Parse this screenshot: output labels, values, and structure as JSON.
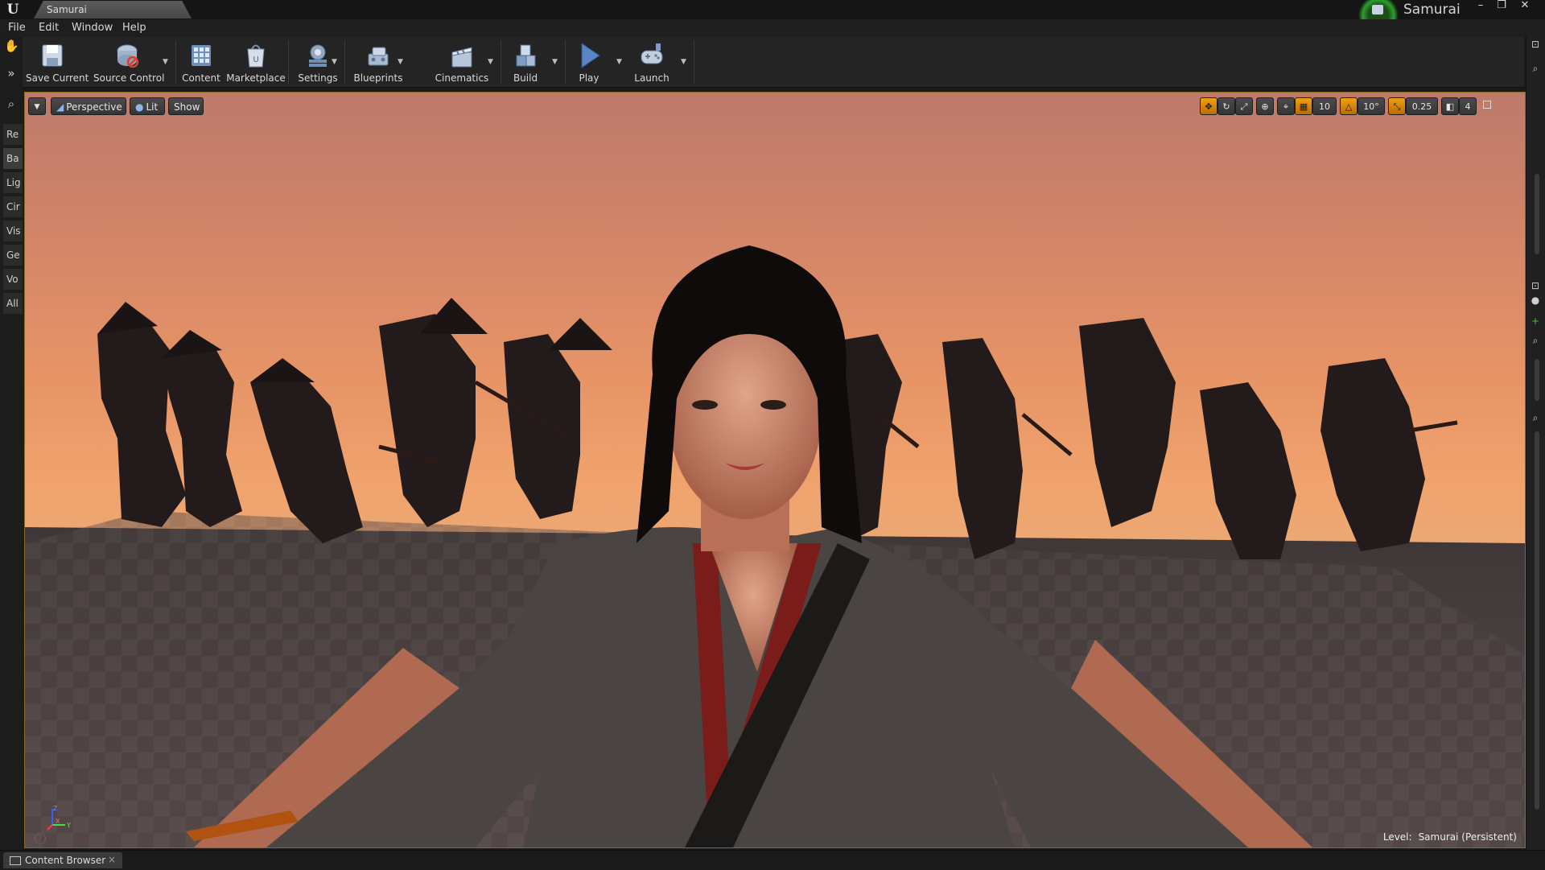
{
  "window": {
    "tab_title": "Samurai",
    "project_name": "Samurai",
    "controls": [
      "minimize",
      "maximize",
      "close"
    ]
  },
  "menu": {
    "items": [
      "File",
      "Edit",
      "Window",
      "Help"
    ]
  },
  "toolbar": {
    "save_current": "Save Current",
    "source_control": "Source Control",
    "content": "Content",
    "marketplace": "Marketplace",
    "settings": "Settings",
    "blueprints": "Blueprints",
    "cinematics": "Cinematics",
    "build": "Build",
    "play": "Play",
    "launch": "Launch"
  },
  "modes": {
    "tabs": [
      "Re",
      "Ba",
      "Lig",
      "Cir",
      "Vis",
      "Ge",
      "Vo",
      "All"
    ],
    "active": "Ba"
  },
  "viewport": {
    "view_mode": "Perspective",
    "lighting": "Lit",
    "show": "Show",
    "grid_snap": "10",
    "rotation_snap": "10°",
    "scale_snap": "0.25",
    "camera_speed": "4",
    "level_label": "Level:",
    "level_name": "Samurai (Persistent)",
    "axis_labels": [
      "Z",
      "X",
      "Y"
    ]
  },
  "bottom": {
    "content_browser": "Content Browser",
    "close_glyph": "×"
  },
  "colors": {
    "accent": "#f0a014",
    "viewport_border": "#8a6a23",
    "sky_top": "#bd7a6b",
    "sky_bottom": "#eca874"
  }
}
